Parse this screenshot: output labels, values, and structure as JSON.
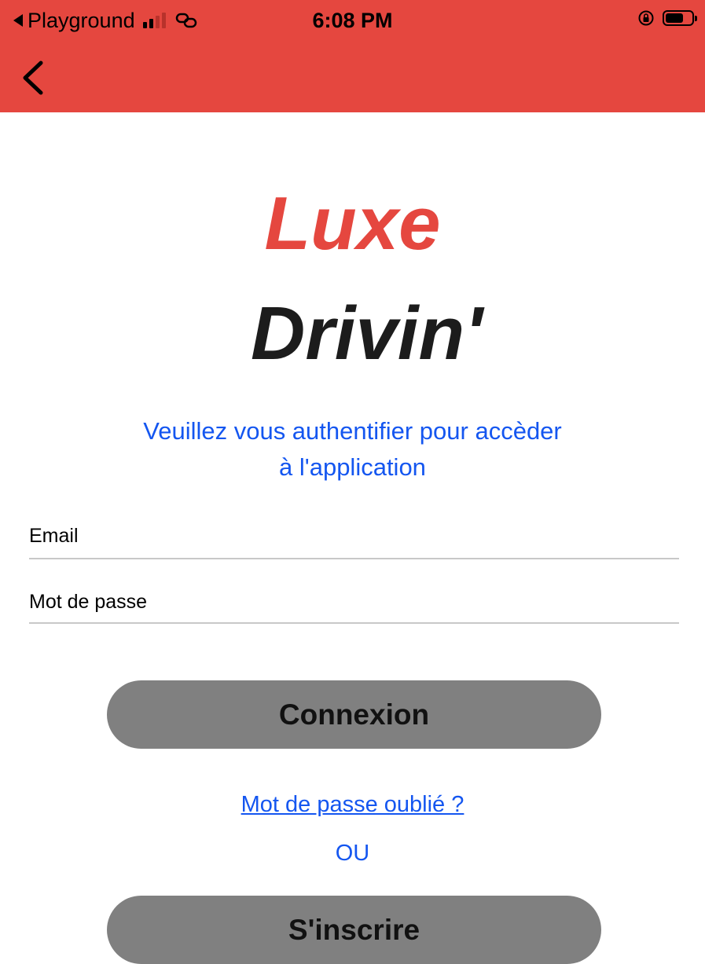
{
  "status_bar": {
    "carrier": "Playground",
    "time": "6:08 PM"
  },
  "header": {
    "color": "#e5473f"
  },
  "logo": {
    "line1": "Luxe",
    "line2": "Drivin'",
    "line1_color": "#e5473f",
    "line2_color": "#1c1c1c"
  },
  "subtitle": {
    "line1": "Veuillez vous authentifier pour accèder",
    "line2": "à l'application"
  },
  "form": {
    "email_placeholder": "Email",
    "password_placeholder": "Mot de passe",
    "login_label": "Connexion",
    "forgot_label": "Mot de passe oublié ?",
    "or_label": "OU",
    "register_label": "S'inscrire"
  },
  "icons": {
    "back": "chevron-left-icon",
    "link": "link-icon",
    "orientation_lock": "orientation-lock-icon",
    "battery": "battery-icon"
  },
  "colors": {
    "accent": "#e5473f",
    "link": "#1456f0",
    "button": "#808080"
  }
}
